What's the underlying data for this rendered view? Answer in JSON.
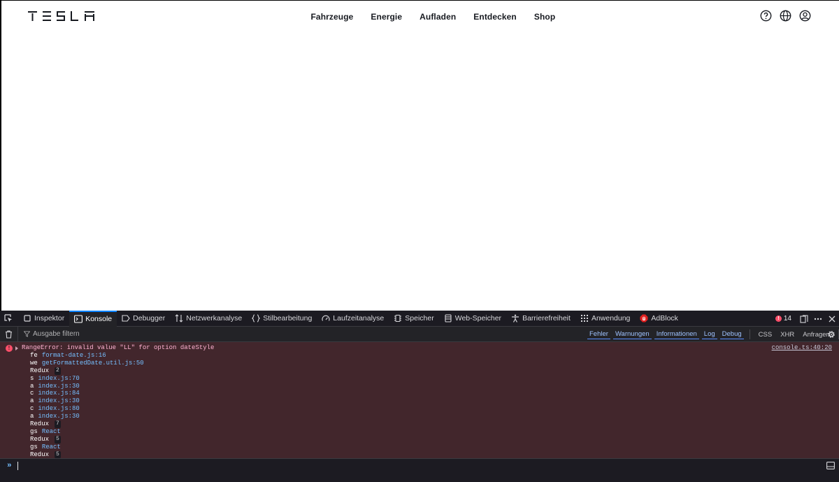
{
  "site": {
    "logo_text": "TESLA",
    "nav": [
      "Fahrzeuge",
      "Energie",
      "Aufladen",
      "Entdecken",
      "Shop"
    ],
    "icons": [
      "help-icon",
      "globe-icon",
      "account-icon"
    ]
  },
  "devtools": {
    "tabs": [
      {
        "id": "inspektor",
        "label": "Inspektor",
        "icon": "inspector-icon"
      },
      {
        "id": "konsole",
        "label": "Konsole",
        "icon": "console-icon",
        "active": true
      },
      {
        "id": "debugger",
        "label": "Debugger",
        "icon": "debugger-icon"
      },
      {
        "id": "netzwerk",
        "label": "Netzwerkanalyse",
        "icon": "network-icon"
      },
      {
        "id": "stil",
        "label": "Stilbearbeitung",
        "icon": "style-editor-icon"
      },
      {
        "id": "laufzeit",
        "label": "Laufzeitanalyse",
        "icon": "performance-icon"
      },
      {
        "id": "speicher",
        "label": "Speicher",
        "icon": "memory-icon"
      },
      {
        "id": "webspeicher",
        "label": "Web-Speicher",
        "icon": "storage-icon"
      },
      {
        "id": "barriere",
        "label": "Barrierefreiheit",
        "icon": "accessibility-icon"
      },
      {
        "id": "anwendung",
        "label": "Anwendung",
        "icon": "application-icon"
      },
      {
        "id": "adblock",
        "label": "AdBlock",
        "icon": "adblock-icon"
      }
    ],
    "error_count": "14",
    "filter_placeholder": "Ausgabe filtern",
    "levels": [
      "Fehler",
      "Warnungen",
      "Informationen",
      "Log",
      "Debug"
    ],
    "requests": [
      "CSS",
      "XHR",
      "Anfragen"
    ],
    "error": {
      "message": "RangeError: invalid value \"LL\" for option dateStyle",
      "source": "console.ts:40:20",
      "stack": [
        {
          "fn": "fe",
          "loc": "format-date.js:16"
        },
        {
          "fn": "we",
          "loc": "getFormattedDate.util.js:50"
        },
        {
          "group": "Redux",
          "count": "2"
        },
        {
          "fn": "s",
          "loc": "index.js:70"
        },
        {
          "fn": "a",
          "loc": "index.js:30"
        },
        {
          "fn": "c",
          "loc": "index.js:84"
        },
        {
          "fn": "a",
          "loc": "index.js:30"
        },
        {
          "fn": "c",
          "loc": "index.js:80"
        },
        {
          "fn": "a",
          "loc": "index.js:30"
        },
        {
          "group": "Redux",
          "count": "7"
        },
        {
          "fn": "gs",
          "loc": "React"
        },
        {
          "group": "Redux",
          "count": "5"
        },
        {
          "fn": "gs",
          "loc": "React"
        },
        {
          "group": "Redux",
          "count": "5"
        }
      ]
    },
    "prompt": "»"
  }
}
